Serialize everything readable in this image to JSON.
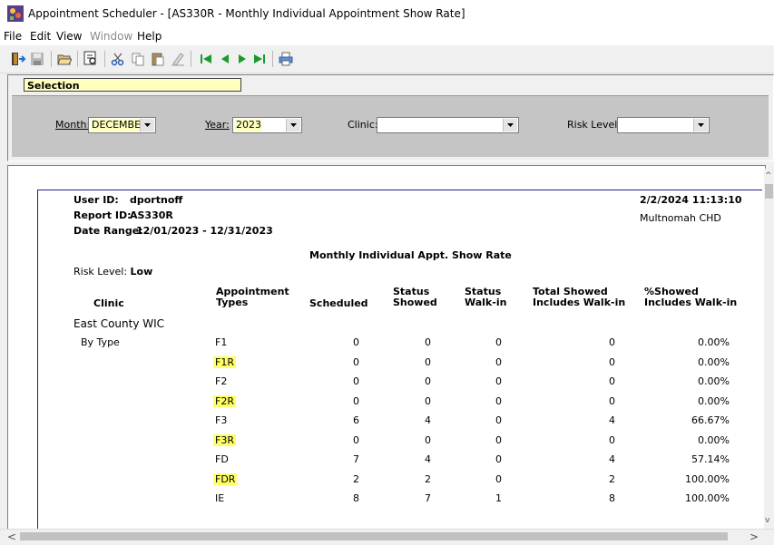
{
  "window": {
    "title": "Appointment Scheduler - [AS330R - Monthly Individual Appointment Show Rate]"
  },
  "menu": [
    "File",
    "Edit",
    "View",
    "Window",
    "Help"
  ],
  "toolbar_icons": [
    "exit-icon",
    "save-icon",
    "open-icon",
    "find-icon",
    "cut-icon",
    "copy-icon",
    "paste-icon",
    "clear-icon",
    "first-record-icon",
    "prev-record-icon",
    "next-record-icon",
    "last-record-icon",
    "print-icon"
  ],
  "selection": {
    "label": "Selection",
    "month": {
      "label": "Month:",
      "value": "DECEMBEI"
    },
    "year": {
      "label": "Year:",
      "value": "2023"
    },
    "clinic": {
      "label": "Clinic:",
      "value": ""
    },
    "risk": {
      "label": "Risk Level:",
      "value": ""
    }
  },
  "report": {
    "user_id_label": "User ID:",
    "user_id": "dportnoff",
    "report_id_label": "Report ID:",
    "report_id": "AS330R",
    "date_range_label": "Date Range:",
    "date_range": "12/01/2023 - 12/31/2023",
    "datetime": "2/2/2024 11:13:10",
    "org": "Multnomah CHD",
    "title": "Monthly Individual Appt. Show Rate",
    "risk_label": "Risk Level:",
    "risk_value": "Low",
    "headers": {
      "clinic": "Clinic",
      "appt1": "Appointment",
      "appt2": "Types",
      "scheduled": "Scheduled",
      "showed1": "Status",
      "showed2": "Showed",
      "walkin1": "Status",
      "walkin2": "Walk-in",
      "total1": "Total Showed",
      "total2": "Includes Walk-in",
      "pct1": "%Showed",
      "pct2": "Includes Walk-in"
    },
    "clinic_name": "East County WIC",
    "group_label": "By Type",
    "rows": [
      {
        "type": "F1",
        "scheduled": "0",
        "showed": "0",
        "walkin": "0",
        "total": "0",
        "pct": "0.00%",
        "highlight": false
      },
      {
        "type": "F1R",
        "scheduled": "0",
        "showed": "0",
        "walkin": "0",
        "total": "0",
        "pct": "0.00%",
        "highlight": true
      },
      {
        "type": "F2",
        "scheduled": "0",
        "showed": "0",
        "walkin": "0",
        "total": "0",
        "pct": "0.00%",
        "highlight": false
      },
      {
        "type": "F2R",
        "scheduled": "0",
        "showed": "0",
        "walkin": "0",
        "total": "0",
        "pct": "0.00%",
        "highlight": true
      },
      {
        "type": "F3",
        "scheduled": "6",
        "showed": "4",
        "walkin": "0",
        "total": "4",
        "pct": "66.67%",
        "highlight": false
      },
      {
        "type": "F3R",
        "scheduled": "0",
        "showed": "0",
        "walkin": "0",
        "total": "0",
        "pct": "0.00%",
        "highlight": true
      },
      {
        "type": "FD",
        "scheduled": "7",
        "showed": "4",
        "walkin": "0",
        "total": "4",
        "pct": "57.14%",
        "highlight": false
      },
      {
        "type": "FDR",
        "scheduled": "2",
        "showed": "2",
        "walkin": "0",
        "total": "2",
        "pct": "100.00%",
        "highlight": true
      },
      {
        "type": "IE",
        "scheduled": "8",
        "showed": "7",
        "walkin": "1",
        "total": "8",
        "pct": "100.00%",
        "highlight": false
      }
    ]
  }
}
